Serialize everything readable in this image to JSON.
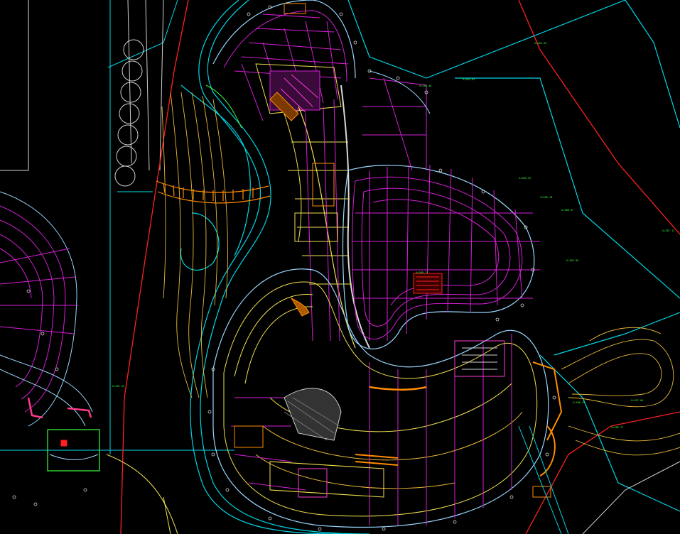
{
  "drawing": {
    "background": "#000000",
    "layer_colors": {
      "site_boundary": "#ff2020",
      "road": "#00d7e6",
      "contour": "#e8b93a",
      "grid": "#d61fd6",
      "building": "#f0e050",
      "annotation": "#39ff3c",
      "detail": "#9ad7ff",
      "edge": "#e5e5e5"
    },
    "annotations": [
      "X=283.59",
      "X=284.63",
      "X=285.48",
      "X=285.42",
      "X=286.18",
      "X=286.67",
      "X=287.12",
      "X=285.90",
      "X=288.21",
      "X=287.55",
      "X=286.49",
      "X=287.04",
      "X=286.77"
    ]
  }
}
